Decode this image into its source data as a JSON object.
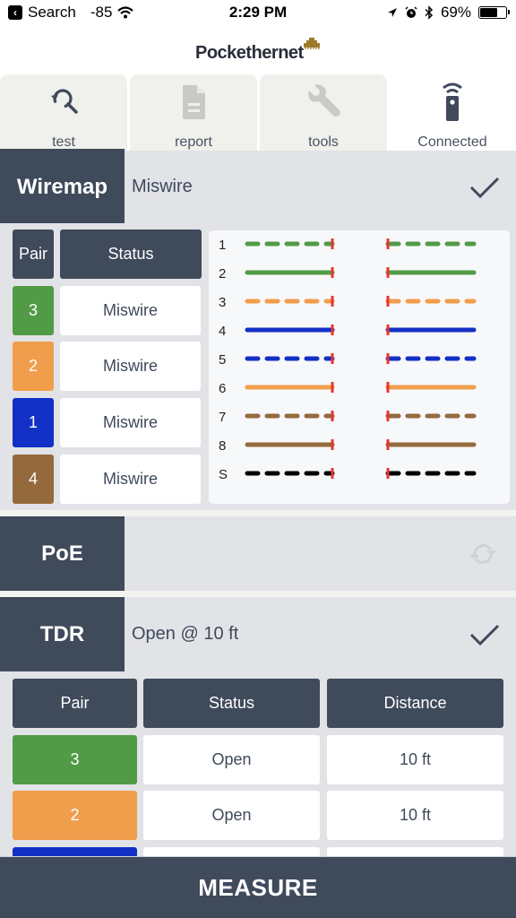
{
  "status_bar": {
    "back_label": "Search",
    "signal": "-85",
    "time": "2:29 PM",
    "battery": "69%",
    "battery_level": 0.69,
    "icons": [
      "location-arrow-icon",
      "alarm-icon",
      "bluetooth-icon",
      "battery-icon"
    ]
  },
  "header": {
    "brand": "Pockethernet"
  },
  "tabs": [
    {
      "label": "test",
      "icon": "search-refresh-icon",
      "active": true
    },
    {
      "label": "report",
      "icon": "document-icon",
      "active": false
    },
    {
      "label": "tools",
      "icon": "wrench-icon",
      "active": false
    },
    {
      "label": "Connected",
      "icon": "remote-device-icon",
      "active": false
    }
  ],
  "wiremap": {
    "label": "Wiremap",
    "result": "Miswire",
    "status_icon": "checkmark-icon",
    "table": {
      "headers": [
        "Pair",
        "Status"
      ],
      "rows": [
        {
          "pair": "3",
          "color": "#529b46",
          "status": "Miswire"
        },
        {
          "pair": "2",
          "color": "#f09e4c",
          "status": "Miswire"
        },
        {
          "pair": "1",
          "color": "#1230c6",
          "status": "Miswire"
        },
        {
          "pair": "4",
          "color": "#946a3d",
          "status": "Miswire"
        }
      ]
    },
    "wires": [
      {
        "label": "1",
        "color": "#529b46",
        "dashed": true
      },
      {
        "label": "2",
        "color": "#529b46",
        "dashed": false
      },
      {
        "label": "3",
        "color": "#f09e4c",
        "dashed": true
      },
      {
        "label": "4",
        "color": "#1230c6",
        "dashed": false
      },
      {
        "label": "5",
        "color": "#1230c6",
        "dashed": true
      },
      {
        "label": "6",
        "color": "#f09e4c",
        "dashed": false
      },
      {
        "label": "7",
        "color": "#946a3d",
        "dashed": true
      },
      {
        "label": "8",
        "color": "#946a3d",
        "dashed": false
      },
      {
        "label": "S",
        "color": "#000000",
        "dashed": true
      }
    ],
    "break_marker_color": "#e8352f"
  },
  "poe": {
    "label": "PoE",
    "result": "",
    "status_icon": "refresh-icon"
  },
  "tdr": {
    "label": "TDR",
    "result": "Open @ 10 ft",
    "status_icon": "checkmark-icon",
    "table": {
      "headers": [
        "Pair",
        "Status",
        "Distance"
      ],
      "rows": [
        {
          "pair": "3",
          "color": "#529b46",
          "status": "Open",
          "distance": "10 ft"
        },
        {
          "pair": "2",
          "color": "#f09e4c",
          "status": "Open",
          "distance": "10 ft"
        },
        {
          "pair": "",
          "color": "#1230c6",
          "status": "",
          "distance": ""
        }
      ]
    }
  },
  "measure_button": "MEASURE",
  "colors": {
    "primary": "#3f4a5b",
    "background": "#e2e3e7",
    "tab_bg": "#f0f0ec"
  }
}
